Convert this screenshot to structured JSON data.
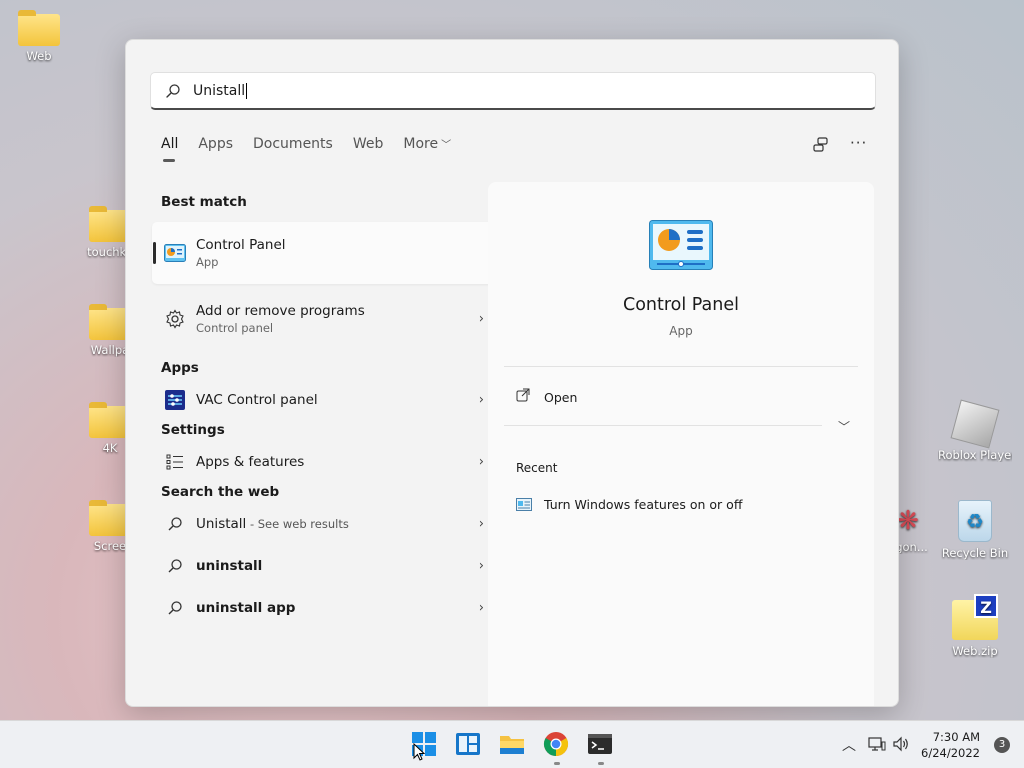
{
  "desktop": {
    "icons": [
      {
        "label": "Web"
      },
      {
        "label": "touchke"
      },
      {
        "label": "Wallpa"
      },
      {
        "label": "4K"
      },
      {
        "label": "Scree"
      },
      {
        "label": "Roblox Player"
      },
      {
        "label": "agon..."
      },
      {
        "label": "Recycle Bin"
      },
      {
        "label": "Web.zip"
      }
    ]
  },
  "search": {
    "query": "Unistall"
  },
  "tabs": [
    {
      "label": "All",
      "active": true
    },
    {
      "label": "Apps"
    },
    {
      "label": "Documents"
    },
    {
      "label": "Web"
    },
    {
      "label": "More"
    }
  ],
  "sections": {
    "best_match": "Best match",
    "apps": "Apps",
    "settings": "Settings",
    "web": "Search the web"
  },
  "results": {
    "best": {
      "title": "Control Panel",
      "sub": "App"
    },
    "add_remove": {
      "title": "Add or remove programs",
      "sub": "Control panel"
    },
    "vac": {
      "title": "VAC Control panel"
    },
    "apps_features": {
      "title": "Apps & features"
    },
    "web1": {
      "title": "Unistall",
      "hint": " - See web results"
    },
    "web2": {
      "title": "uninstall"
    },
    "web3": {
      "title": "uninstall app"
    }
  },
  "detail": {
    "title": "Control Panel",
    "sub": "App",
    "open": "Open",
    "recent_title": "Recent",
    "recent_item": "Turn Windows features on or off"
  },
  "taskbar": {
    "time": "7:30 AM",
    "date": "6/24/2022",
    "notifications": "3"
  },
  "colors": {
    "accent": "#0078d4",
    "panel_bg": "#f3f3f3",
    "taskbar_bg": "#eef0f3"
  }
}
